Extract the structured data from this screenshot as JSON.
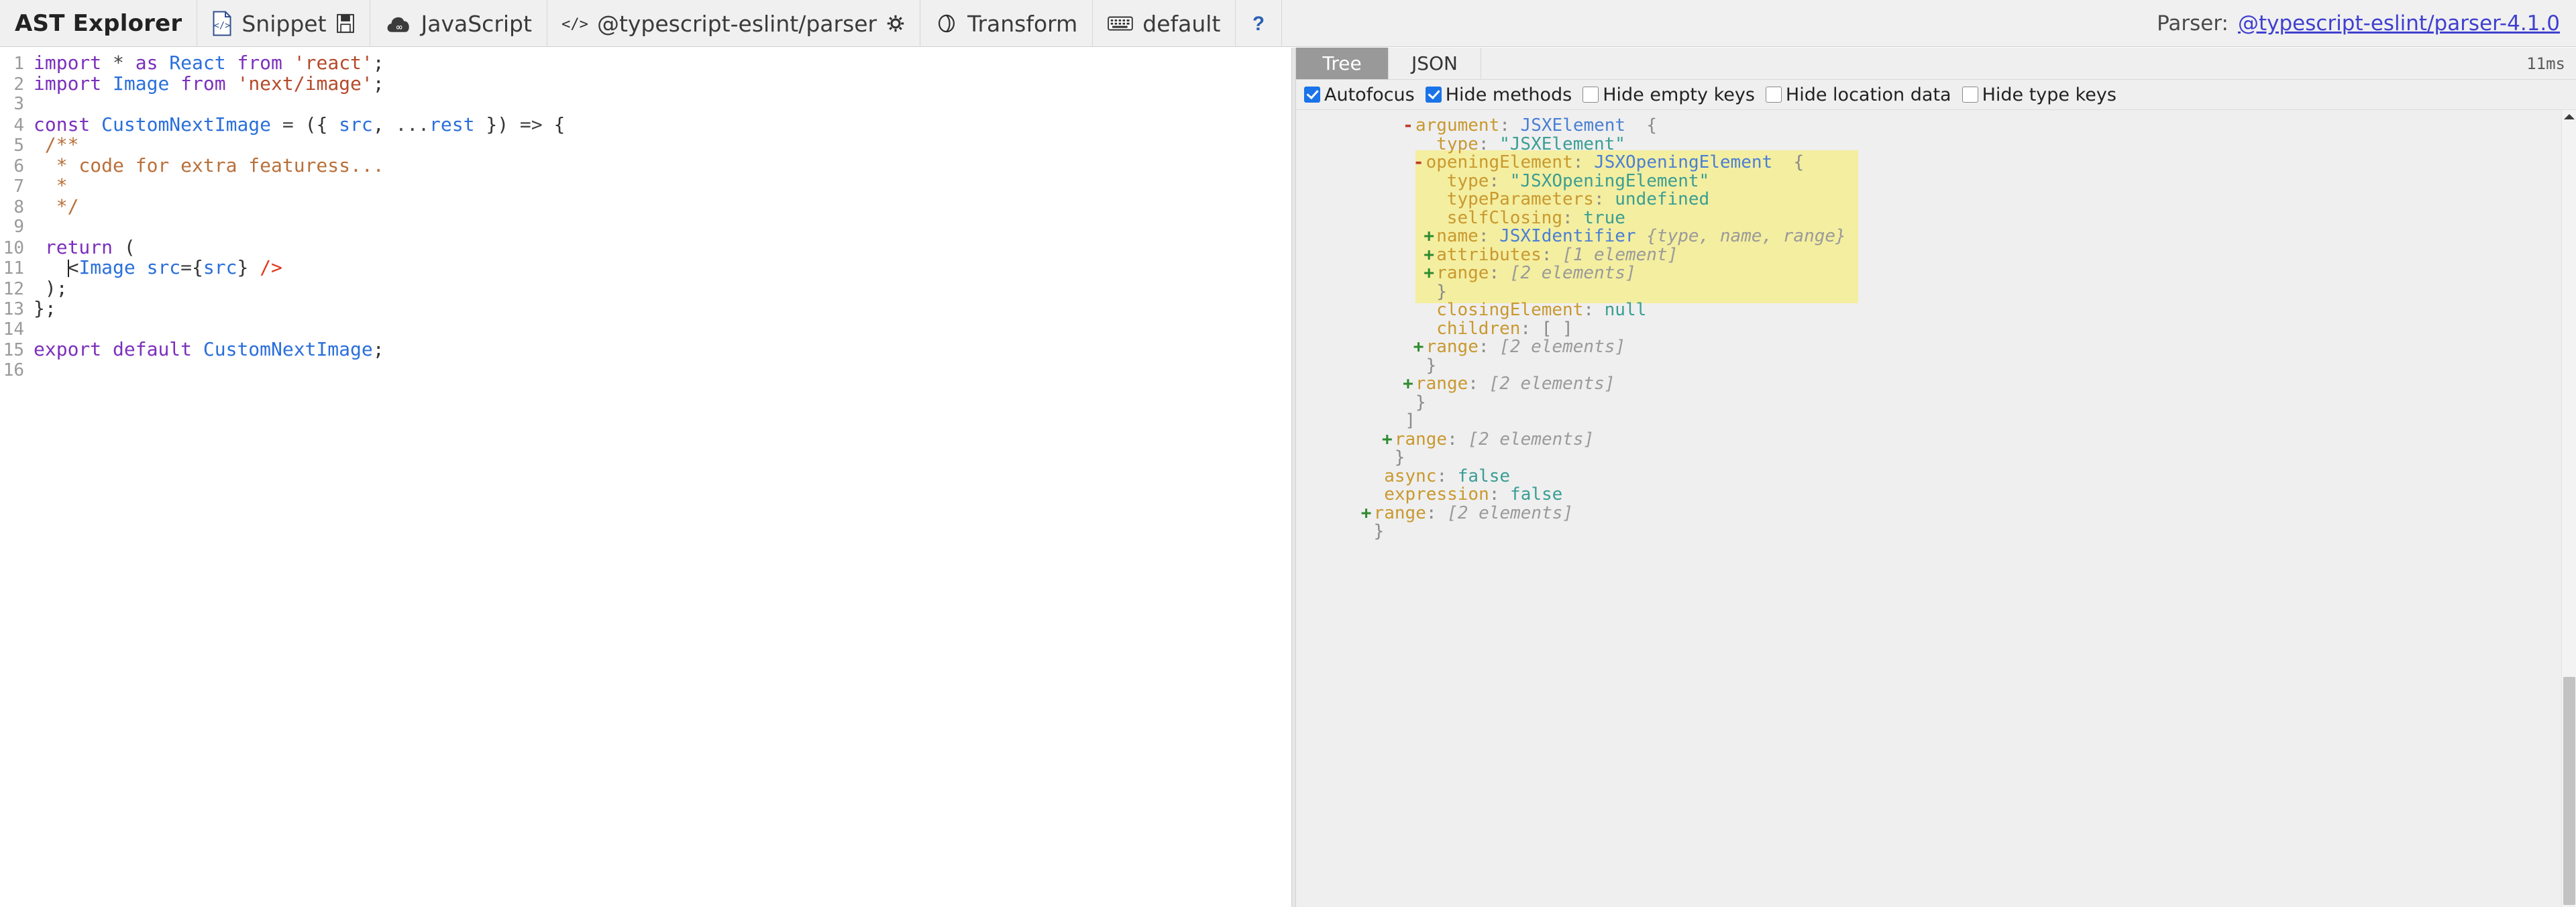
{
  "toolbar": {
    "brand": "AST Explorer",
    "snippet_label": "Snippet",
    "snippet_icon": "code-file-icon",
    "save_icon": "floppy-disk-icon",
    "language_label": "JavaScript",
    "language_icon": "babel-cloud-icon",
    "parser_label": "@typescript-eslint/parser",
    "parser_icon": "code-brackets-icon",
    "settings_icon": "gear-icon",
    "transform_label": "Transform",
    "transform_icon": "transform-circle-icon",
    "keymap_label": "default",
    "keymap_icon": "keyboard-icon",
    "help_icon": "question-mark-icon",
    "parser_prefix": "Parser:",
    "parser_version_link": "@typescript-eslint/parser-4.1.0"
  },
  "editor": {
    "lines": [
      {
        "n": "1",
        "tokens": [
          {
            "t": "import ",
            "c": "k-kw"
          },
          {
            "t": "* ",
            "c": "k-op"
          },
          {
            "t": "as ",
            "c": "k-kw"
          },
          {
            "t": "React ",
            "c": "k-def"
          },
          {
            "t": "from ",
            "c": "k-kw"
          },
          {
            "t": "'react'",
            "c": "k-str"
          },
          {
            "t": ";",
            "c": "k-punc"
          }
        ]
      },
      {
        "n": "2",
        "tokens": [
          {
            "t": "import ",
            "c": "k-kw"
          },
          {
            "t": "Image ",
            "c": "k-def"
          },
          {
            "t": "from ",
            "c": "k-kw"
          },
          {
            "t": "'next/image'",
            "c": "k-str"
          },
          {
            "t": ";",
            "c": "k-punc"
          }
        ]
      },
      {
        "n": "3",
        "tokens": []
      },
      {
        "n": "4",
        "tokens": [
          {
            "t": "const ",
            "c": "k-kw"
          },
          {
            "t": "CustomNextImage ",
            "c": "k-def"
          },
          {
            "t": "= ",
            "c": "k-op"
          },
          {
            "t": "({ ",
            "c": "k-punc"
          },
          {
            "t": "src",
            "c": "k-def"
          },
          {
            "t": ", ",
            "c": "k-punc"
          },
          {
            "t": "...",
            "c": "k-op"
          },
          {
            "t": "rest",
            "c": "k-def"
          },
          {
            "t": " }) ",
            "c": "k-punc"
          },
          {
            "t": "=> ",
            "c": "k-op"
          },
          {
            "t": "{",
            "c": "k-punc"
          }
        ]
      },
      {
        "n": "5",
        "tokens": [
          {
            "t": " /**",
            "c": "k-cmt"
          }
        ]
      },
      {
        "n": "6",
        "tokens": [
          {
            "t": "  * code for extra featuress...",
            "c": "k-cmt"
          }
        ]
      },
      {
        "n": "7",
        "tokens": [
          {
            "t": "  *",
            "c": "k-cmt"
          }
        ]
      },
      {
        "n": "8",
        "tokens": [
          {
            "t": "  */",
            "c": "k-cmt"
          }
        ]
      },
      {
        "n": "9",
        "tokens": []
      },
      {
        "n": "10",
        "tokens": [
          {
            "t": " ",
            "c": "k-punc"
          },
          {
            "t": "return ",
            "c": "k-kw"
          },
          {
            "t": "(",
            "c": "k-punc"
          }
        ]
      },
      {
        "n": "11",
        "tokens": [
          {
            "t": "   ",
            "c": "k-punc"
          },
          {
            "t": "CARET",
            "c": "caret"
          },
          {
            "t": "<",
            "c": "k-punc"
          },
          {
            "t": "Image ",
            "c": "k-tag"
          },
          {
            "t": "src",
            "c": "k-def"
          },
          {
            "t": "=",
            "c": "k-op"
          },
          {
            "t": "{",
            "c": "k-punc"
          },
          {
            "t": "src",
            "c": "k-def"
          },
          {
            "t": "} ",
            "c": "k-punc"
          },
          {
            "t": "/>",
            "c": "k-red"
          }
        ]
      },
      {
        "n": "12",
        "tokens": [
          {
            "t": " );",
            "c": "k-punc"
          }
        ]
      },
      {
        "n": "13",
        "tokens": [
          {
            "t": "};",
            "c": "k-punc"
          }
        ]
      },
      {
        "n": "14",
        "tokens": []
      },
      {
        "n": "15",
        "tokens": [
          {
            "t": "export ",
            "c": "k-kw"
          },
          {
            "t": "default ",
            "c": "k-kw"
          },
          {
            "t": "CustomNextImage",
            "c": "k-def"
          },
          {
            "t": ";",
            "c": "k-punc"
          }
        ]
      },
      {
        "n": "16",
        "tokens": []
      }
    ]
  },
  "right_panel": {
    "tabs": [
      {
        "label": "Tree",
        "active": true
      },
      {
        "label": "JSON",
        "active": false
      }
    ],
    "timing": "11ms",
    "options": [
      {
        "label": "Autofocus",
        "checked": true
      },
      {
        "label": "Hide methods",
        "checked": true
      },
      {
        "label": "Hide empty keys",
        "checked": false
      },
      {
        "label": "Hide location data",
        "checked": false
      },
      {
        "label": "Hide type keys",
        "checked": false
      }
    ],
    "tree": [
      {
        "indent": 10,
        "toggle": "-",
        "highlight": false,
        "tokens": [
          {
            "t": "argument",
            "c": "t-key"
          },
          {
            "t": ": ",
            "c": "t-punc"
          },
          {
            "t": "JSXElement",
            "c": "t-type"
          },
          {
            "t": "  {",
            "c": "t-punc"
          }
        ]
      },
      {
        "indent": 12,
        "toggle": "",
        "highlight": false,
        "tokens": [
          {
            "t": "type",
            "c": "t-key"
          },
          {
            "t": ": ",
            "c": "t-punc"
          },
          {
            "t": "\"JSXElement\"",
            "c": "t-str"
          }
        ]
      },
      {
        "indent": 11,
        "toggle": "-",
        "highlight": true,
        "tokens": [
          {
            "t": "openingElement",
            "c": "t-key"
          },
          {
            "t": ": ",
            "c": "t-punc"
          },
          {
            "t": "JSXOpeningElement",
            "c": "t-type"
          },
          {
            "t": "  {",
            "c": "t-punc"
          }
        ]
      },
      {
        "indent": 13,
        "toggle": "",
        "highlight": true,
        "tokens": [
          {
            "t": "type",
            "c": "t-key"
          },
          {
            "t": ": ",
            "c": "t-punc"
          },
          {
            "t": "\"JSXOpeningElement\"",
            "c": "t-str"
          }
        ]
      },
      {
        "indent": 13,
        "toggle": "",
        "highlight": true,
        "tokens": [
          {
            "t": "typeParameters",
            "c": "t-key"
          },
          {
            "t": ": ",
            "c": "t-punc"
          },
          {
            "t": "undefined",
            "c": "t-lit"
          }
        ]
      },
      {
        "indent": 13,
        "toggle": "",
        "highlight": true,
        "tokens": [
          {
            "t": "selfClosing",
            "c": "t-key"
          },
          {
            "t": ": ",
            "c": "t-punc"
          },
          {
            "t": "true",
            "c": "t-lit"
          }
        ]
      },
      {
        "indent": 12,
        "toggle": "+",
        "highlight": true,
        "tokens": [
          {
            "t": "name",
            "c": "t-key"
          },
          {
            "t": ": ",
            "c": "t-punc"
          },
          {
            "t": "JSXIdentifier",
            "c": "t-type"
          },
          {
            "t": " {type, name, range}",
            "c": "t-prev"
          }
        ]
      },
      {
        "indent": 12,
        "toggle": "+",
        "highlight": true,
        "tokens": [
          {
            "t": "attributes",
            "c": "t-key"
          },
          {
            "t": ": ",
            "c": "t-punc"
          },
          {
            "t": "[1 element]",
            "c": "t-prev"
          }
        ]
      },
      {
        "indent": 12,
        "toggle": "+",
        "highlight": true,
        "tokens": [
          {
            "t": "range",
            "c": "t-key"
          },
          {
            "t": ": ",
            "c": "t-punc"
          },
          {
            "t": "[2 elements]",
            "c": "t-prev"
          }
        ]
      },
      {
        "indent": 12,
        "toggle": "",
        "highlight": true,
        "tokens": [
          {
            "t": "}",
            "c": "t-punc"
          }
        ]
      },
      {
        "indent": 12,
        "toggle": "",
        "highlight": false,
        "tokens": [
          {
            "t": "closingElement",
            "c": "t-key"
          },
          {
            "t": ": ",
            "c": "t-punc"
          },
          {
            "t": "null",
            "c": "t-lit"
          }
        ]
      },
      {
        "indent": 12,
        "toggle": "",
        "highlight": false,
        "tokens": [
          {
            "t": "children",
            "c": "t-key"
          },
          {
            "t": ": ",
            "c": "t-punc"
          },
          {
            "t": "[ ]",
            "c": "t-punc"
          }
        ]
      },
      {
        "indent": 11,
        "toggle": "+",
        "highlight": false,
        "tokens": [
          {
            "t": "range",
            "c": "t-key"
          },
          {
            "t": ": ",
            "c": "t-punc"
          },
          {
            "t": "[2 elements]",
            "c": "t-prev"
          }
        ]
      },
      {
        "indent": 11,
        "toggle": "",
        "highlight": false,
        "tokens": [
          {
            "t": "}",
            "c": "t-punc"
          }
        ]
      },
      {
        "indent": 10,
        "toggle": "+",
        "highlight": false,
        "tokens": [
          {
            "t": "range",
            "c": "t-key"
          },
          {
            "t": ": ",
            "c": "t-punc"
          },
          {
            "t": "[2 elements]",
            "c": "t-prev"
          }
        ]
      },
      {
        "indent": 10,
        "toggle": "",
        "highlight": false,
        "tokens": [
          {
            "t": "}",
            "c": "t-punc"
          }
        ]
      },
      {
        "indent": 9,
        "toggle": "",
        "highlight": false,
        "tokens": [
          {
            "t": "]",
            "c": "t-punc"
          }
        ]
      },
      {
        "indent": 8,
        "toggle": "+",
        "highlight": false,
        "tokens": [
          {
            "t": "range",
            "c": "t-key"
          },
          {
            "t": ": ",
            "c": "t-punc"
          },
          {
            "t": "[2 elements]",
            "c": "t-prev"
          }
        ]
      },
      {
        "indent": 8,
        "toggle": "",
        "highlight": false,
        "tokens": [
          {
            "t": "}",
            "c": "t-punc"
          }
        ]
      },
      {
        "indent": 7,
        "toggle": "",
        "highlight": false,
        "tokens": [
          {
            "t": "async",
            "c": "t-key"
          },
          {
            "t": ": ",
            "c": "t-punc"
          },
          {
            "t": "false",
            "c": "t-lit"
          }
        ]
      },
      {
        "indent": 7,
        "toggle": "",
        "highlight": false,
        "tokens": [
          {
            "t": "expression",
            "c": "t-key"
          },
          {
            "t": ": ",
            "c": "t-punc"
          },
          {
            "t": "false",
            "c": "t-lit"
          }
        ]
      },
      {
        "indent": 6,
        "toggle": "+",
        "highlight": false,
        "tokens": [
          {
            "t": "range",
            "c": "t-key"
          },
          {
            "t": ": ",
            "c": "t-punc"
          },
          {
            "t": "[2 elements]",
            "c": "t-prev"
          }
        ]
      },
      {
        "indent": 6,
        "toggle": "",
        "highlight": false,
        "tokens": [
          {
            "t": "}",
            "c": "t-punc"
          }
        ]
      }
    ]
  },
  "colors": {
    "toolbar_bg": "#f0f0f0",
    "panel_bg": "#efefef",
    "editor_bg": "#ffffff",
    "active_tab_bg": "#999999",
    "highlight_bg": "#f4eea0",
    "checkbox_on": "#1a73e8",
    "link": "#3f3fd0"
  }
}
